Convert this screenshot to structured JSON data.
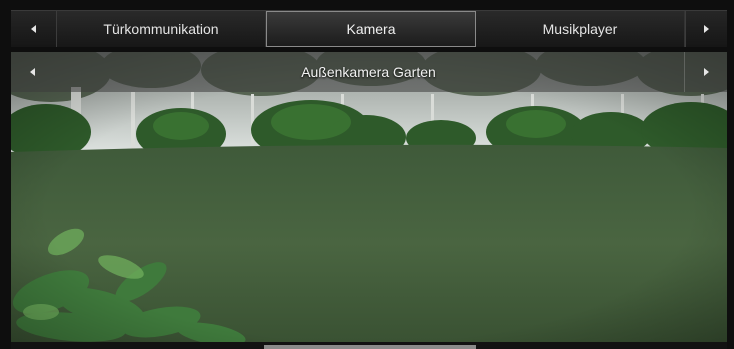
{
  "tabs": {
    "items": [
      {
        "label": "Türkommunikation"
      },
      {
        "label": "Kamera"
      },
      {
        "label": "Musikplayer"
      }
    ],
    "active_index": 1
  },
  "camera": {
    "title": "Außenkamera Garten"
  },
  "icons": {
    "prev": "triangle-left-icon",
    "next": "triangle-right-icon"
  },
  "colors": {
    "background": "#0e0e0e",
    "tab_text": "#e4e4e4",
    "active_border": "#8a8a8a"
  }
}
